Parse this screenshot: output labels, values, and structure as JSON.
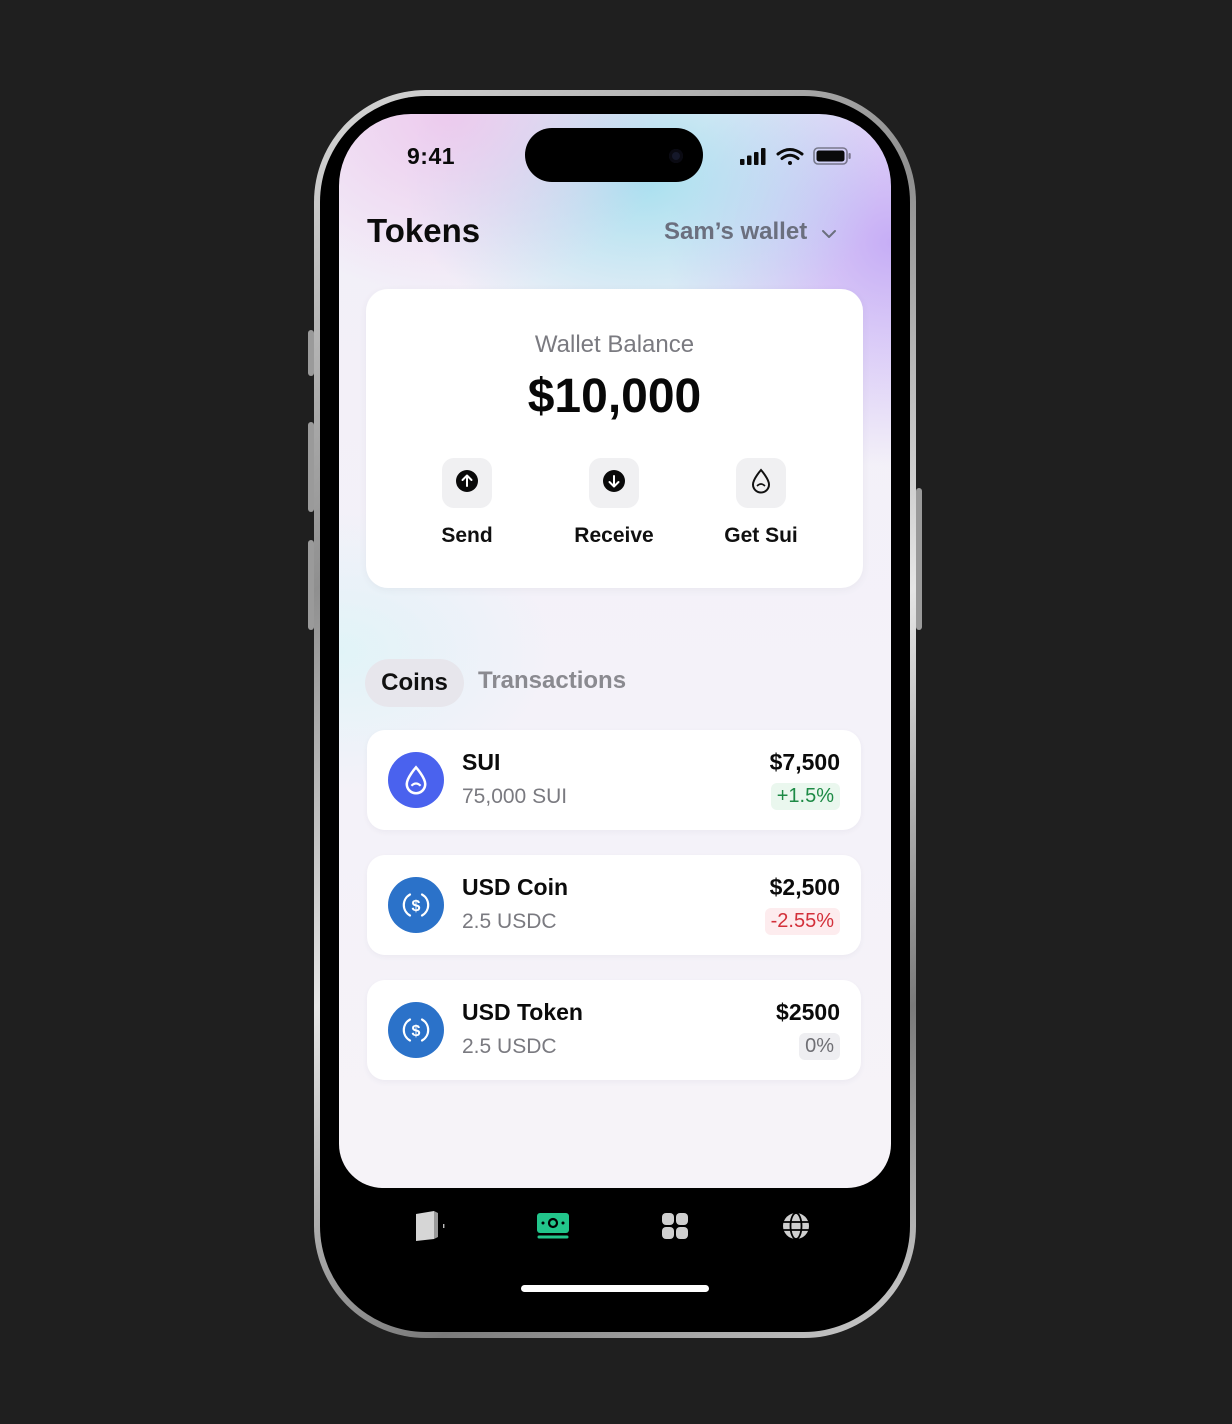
{
  "status_bar": {
    "time": "9:41"
  },
  "header": {
    "title": "Tokens",
    "wallet_name": "Sam’s wallet"
  },
  "balance": {
    "label": "Wallet Balance",
    "value": "$10,000",
    "actions": [
      {
        "label": "Send",
        "icon": "arrow-up-icon"
      },
      {
        "label": "Receive",
        "icon": "arrow-down-icon"
      },
      {
        "label": "Get Sui",
        "icon": "sui-drop-icon"
      }
    ]
  },
  "tabs": [
    {
      "label": "Coins",
      "active": true
    },
    {
      "label": "Transactions",
      "active": false
    }
  ],
  "tokens": [
    {
      "name": "SUI",
      "amount": "75,000 SUI",
      "value": "$7,500",
      "change": "+1.5%",
      "trend": "up",
      "icon": "sui-logo-icon"
    },
    {
      "name": "USD Coin",
      "amount": "2.5 USDC",
      "value": "$2,500",
      "change": "-2.55%",
      "trend": "down",
      "icon": "usdc-logo-icon"
    },
    {
      "name": "USD Token",
      "amount": "2.5 USDC",
      "value": "$2500",
      "change": "0%",
      "trend": "flat",
      "icon": "usdc-logo-icon"
    }
  ],
  "bottom_nav": [
    {
      "icon": "wallet-icon"
    },
    {
      "icon": "cash-icon",
      "active": true,
      "color": "#22c58b"
    },
    {
      "icon": "apps-grid-icon"
    },
    {
      "icon": "globe-icon"
    }
  ],
  "colors": {
    "sui_brand": "#4a62ee",
    "usdc_brand": "#2b72c9",
    "positive": "#1d8a45",
    "negative": "#d3303a",
    "nav_active": "#22c58b"
  }
}
